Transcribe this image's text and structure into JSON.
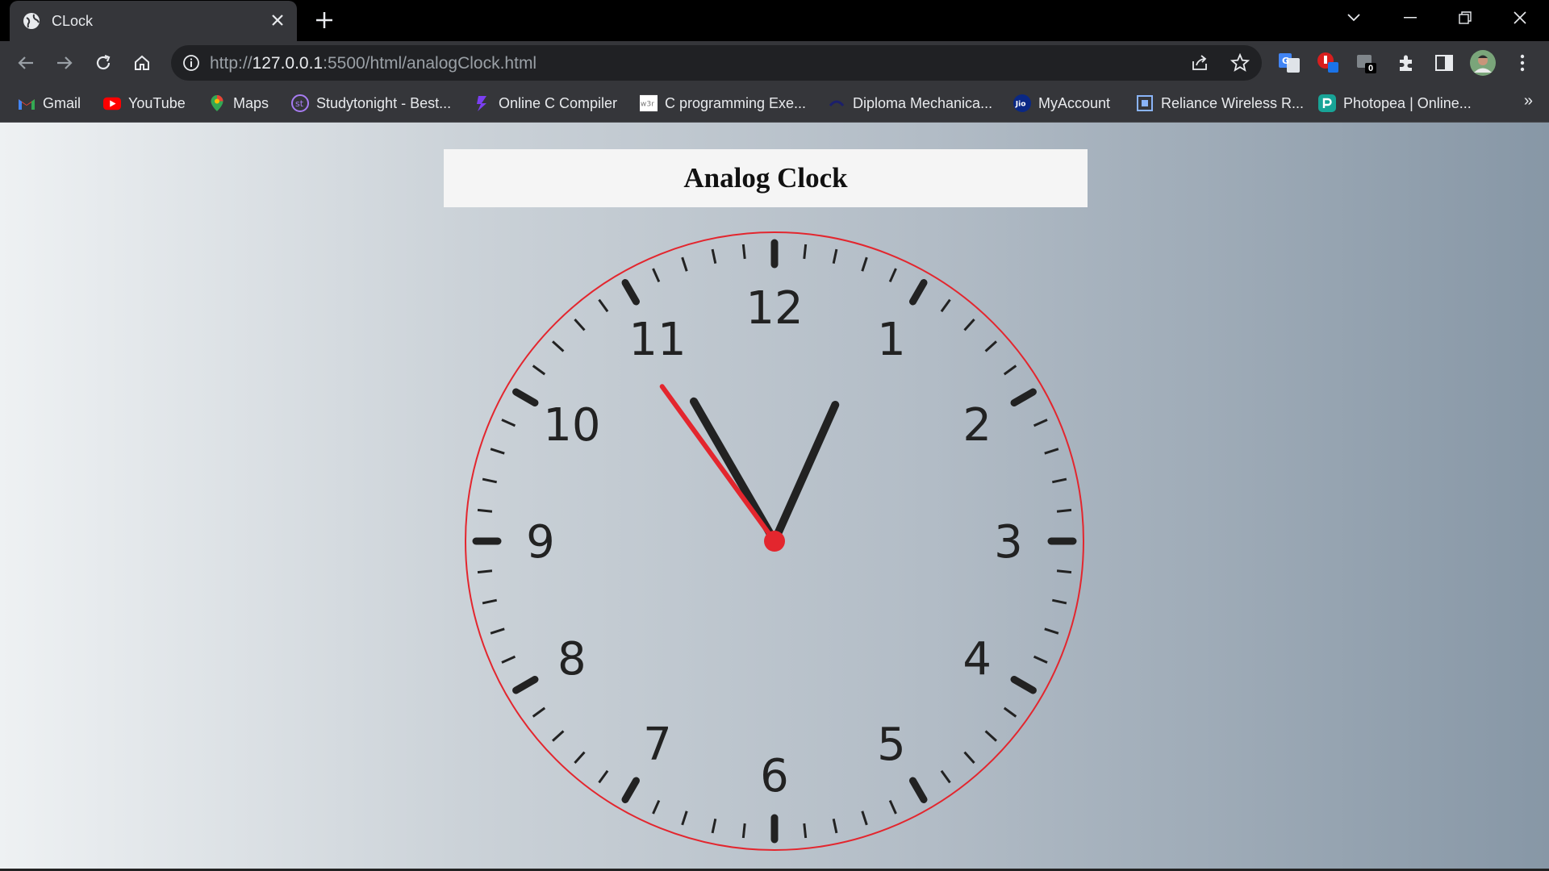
{
  "browser": {
    "tab": {
      "title": "CLock",
      "favicon": "globe-icon"
    },
    "new_tab_label": "+",
    "url": {
      "scheme": "http://",
      "host": "127.0.0.1",
      "rest": ":5500/html/analogClock.html"
    },
    "bookmarks": [
      {
        "label": "Gmail",
        "icon": "gmail-icon"
      },
      {
        "label": "YouTube",
        "icon": "youtube-icon"
      },
      {
        "label": "Maps",
        "icon": "maps-icon"
      },
      {
        "label": "Studytonight - Best...",
        "icon": "studytonight-icon"
      },
      {
        "label": "Online C Compiler",
        "icon": "compiler-icon"
      },
      {
        "label": "C programming Exe...",
        "icon": "w3r-icon"
      },
      {
        "label": "Diploma Mechanica...",
        "icon": "diploma-icon"
      },
      {
        "label": "MyAccount",
        "icon": "jio-icon"
      },
      {
        "label": "Reliance Wireless R...",
        "icon": "reliance-icon"
      },
      {
        "label": "Photopea | Online...",
        "icon": "photopea-icon"
      }
    ],
    "bookmarks_overflow": "»",
    "extension_badge": "0"
  },
  "page": {
    "heading": "Analog Clock",
    "clock": {
      "numbers": [
        "12",
        "1",
        "2",
        "3",
        "4",
        "5",
        "6",
        "7",
        "8",
        "9",
        "10",
        "11"
      ],
      "hour_hand_points_to_minute_mark": 55,
      "minute_hand_points_to_minute_mark": 4,
      "second_hand_points_to_minute_mark": 54,
      "colors": {
        "border": "#e3262e",
        "hands": "#222222",
        "second_hand": "#e3262e",
        "center": "#e3262e"
      }
    }
  }
}
